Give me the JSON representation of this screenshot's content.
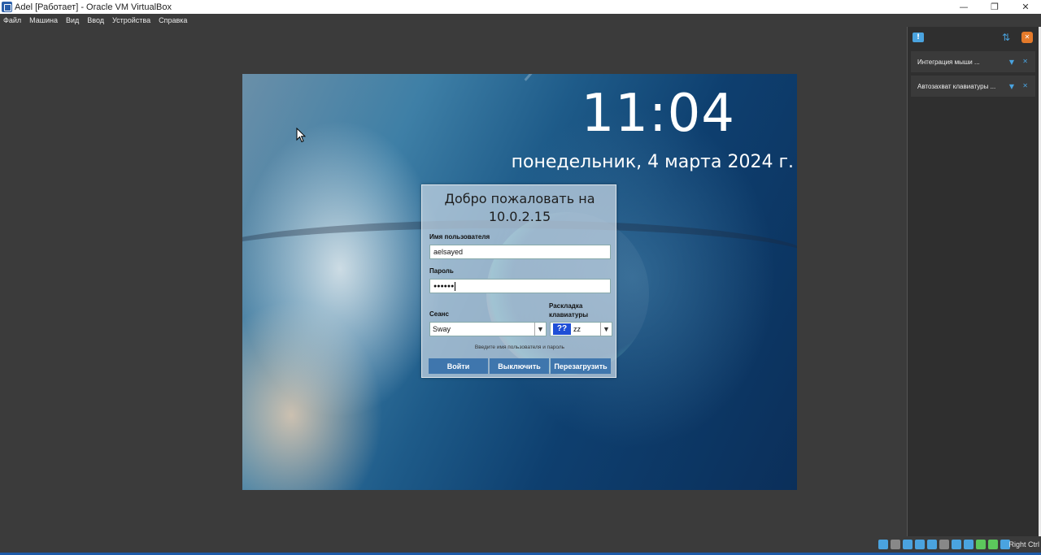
{
  "window": {
    "title": "Adel [Работает] - Oracle VM VirtualBox",
    "minimize_icon": "minimize-icon",
    "restore_icon": "restore-icon",
    "close_icon": "close-icon",
    "minimize_glyph": "—",
    "restore_glyph": "❐",
    "close_glyph": "✕"
  },
  "menu": [
    "Файл",
    "Машина",
    "Вид",
    "Ввод",
    "Устройства",
    "Справка"
  ],
  "vm": {
    "clock": "11:04",
    "date": "понедельник, 4 марта 2024 г.",
    "login": {
      "title_line1": "Добро пожаловать на",
      "title_line2": "10.0.2.15",
      "username_label": "Имя пользователя",
      "username_value": "aelsayed",
      "password_label": "Пароль",
      "password_value": "●●●●●●",
      "session_label": "Сеанс",
      "session_value": "Sway",
      "keyboard_label_line1": "Раскладка",
      "keyboard_label_line2": "клавиатуры",
      "keyboard_flag": "??",
      "keyboard_value": "zz",
      "hint": "Введите имя пользователя и пароль",
      "login_button": "Войти",
      "shutdown_button": "Выключить",
      "restart_button": "Перезагрузить"
    }
  },
  "notifications": {
    "items": [
      {
        "text": "Интеграция мыши ..."
      },
      {
        "text": "Автозахват клавиатуры ..."
      }
    ]
  },
  "statusbar": {
    "host_key": "Right Ctrl",
    "icons": [
      "hard-disk-icon",
      "optical-disk-icon",
      "audio-icon",
      "network-icon",
      "usb-icon",
      "shared-folders-icon",
      "display-icon",
      "video-capture-icon",
      "cpu-icon",
      "mouse-integration-icon",
      "keyboard-icon"
    ],
    "icon_colors": [
      "#4aa3df",
      "#888888",
      "#4aa3df",
      "#4aa3df",
      "#4aa3df",
      "#888888",
      "#4aa3df",
      "#4aa3df",
      "#5cc85c",
      "#5cc85c",
      "#4aa3df"
    ]
  },
  "colors": {
    "accent": "#3f76ad",
    "host_bg": "#3b3b3b",
    "panel_accent": "#4aa3df"
  }
}
